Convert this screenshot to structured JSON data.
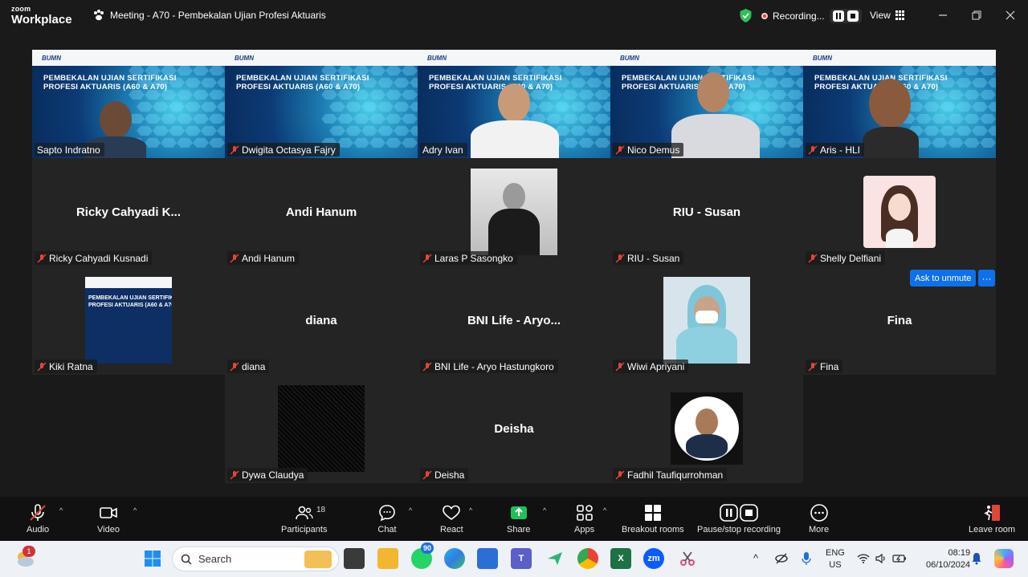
{
  "titlebar": {
    "brand_line1": "zoom",
    "brand_line2": "Workplace",
    "meeting_title": "Meeting - A70 - Pembekalan Ujian Profesi Aktuaris",
    "recording_label": "Recording...",
    "view_label": "View"
  },
  "slide": {
    "title_line1": "PEMBEKALAN UJIAN SERTIFIKASI",
    "title_line2": "PROFESI AKTUARIS (A60 & A70)",
    "logo": "BUMN"
  },
  "participants": [
    {
      "name": "Sapto Indratno",
      "display": "",
      "muted": false
    },
    {
      "name": "Dwigita Octasya Fajry",
      "display": "",
      "muted": true
    },
    {
      "name": "Adry Ivan",
      "display": "",
      "muted": false,
      "active_speaker": true
    },
    {
      "name": "Nico Demus",
      "display": "",
      "muted": true
    },
    {
      "name": "Aris - HLI",
      "display": "",
      "muted": true
    },
    {
      "name": "Ricky Cahyadi Kusnadi",
      "display": "Ricky Cahyadi K...",
      "muted": true
    },
    {
      "name": "Andi Hanum",
      "display": "Andi Hanum",
      "muted": true
    },
    {
      "name": "Laras P Sasongko",
      "display": "",
      "muted": true
    },
    {
      "name": "RIU - Susan",
      "display": "RIU - Susan",
      "muted": true
    },
    {
      "name": "Shelly Delfiani",
      "display": "",
      "muted": true
    },
    {
      "name": "Kiki Ratna",
      "display": "",
      "muted": true
    },
    {
      "name": "diana",
      "display": "diana",
      "muted": true
    },
    {
      "name": "BNI Life - Aryo Hastungkoro",
      "display": "BNI Life - Aryo...",
      "muted": true
    },
    {
      "name": "Wiwi Apriyani",
      "display": "",
      "muted": true
    },
    {
      "name": "Fina",
      "display": "Fina",
      "muted": true
    },
    {
      "name": "Dywa Claudya",
      "display": "",
      "muted": true
    },
    {
      "name": "Deisha",
      "display": "Deisha",
      "muted": true
    },
    {
      "name": "Fadhil Taufiqurrohman",
      "display": "",
      "muted": true
    }
  ],
  "hover_actions": {
    "ask_to_unmute": "Ask to unmute",
    "more": "···"
  },
  "toolbar": {
    "audio": "Audio",
    "video": "Video",
    "participants": "Participants",
    "participants_count": "18",
    "chat": "Chat",
    "react": "React",
    "share": "Share",
    "apps": "Apps",
    "breakout": "Breakout rooms",
    "pause_stop": "Pause/stop recording",
    "more": "More",
    "leave": "Leave room"
  },
  "taskbar": {
    "search_placeholder": "Search",
    "weather_badge": "1",
    "whatsapp_badge": "90",
    "lang_line1": "ENG",
    "lang_line2": "US",
    "time": "08:19",
    "date": "06/10/2024"
  },
  "colors": {
    "background": "#1a1a1a",
    "tile": "#242424",
    "accent_blue": "#0e71eb",
    "active_speaker_border": "#2fd18f",
    "share_green": "#21c05a",
    "mute_red": "#e0463a"
  }
}
